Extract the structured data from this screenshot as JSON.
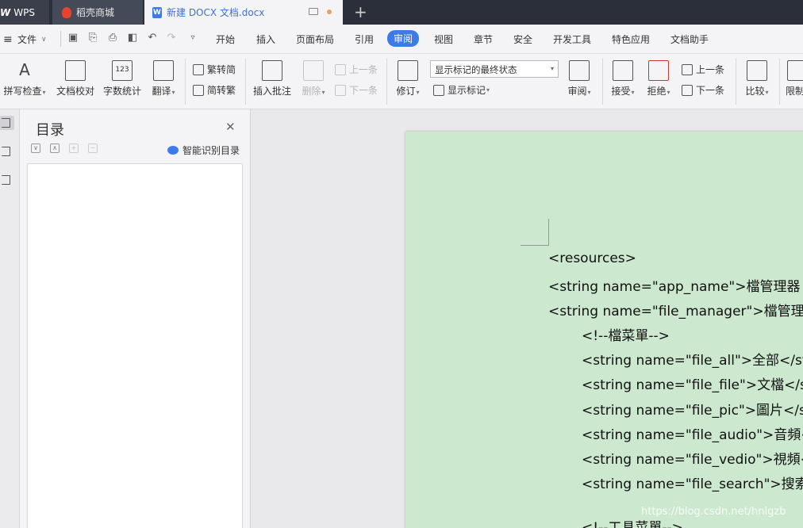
{
  "tabs": {
    "wps": "WPS",
    "store": "稻壳商城",
    "doc": "新建 DOCX 文档.docx"
  },
  "menu": {
    "file": "文件",
    "items": [
      "开始",
      "插入",
      "页面布局",
      "引用",
      "审阅",
      "视图",
      "章节",
      "安全",
      "开发工具",
      "特色应用",
      "文档助手"
    ],
    "active": "审阅"
  },
  "ribbon": {
    "spell_check": "拼写检查",
    "doc_proof": "文档校对",
    "word_count": "字数统计",
    "translate": "翻译",
    "trad_to_simp": "繁转简",
    "simp_to_trad": "简转繁",
    "insert_comment": "插入批注",
    "delete": "删除",
    "prev_comment": "上一条",
    "next_comment": "下一条",
    "track_changes": "修订",
    "markup_select": "显示标记的最终状态",
    "show_markup": "显示标记",
    "review": "审阅",
    "accept": "接受",
    "reject": "拒绝",
    "prev_change": "上一条",
    "next_change": "下一条",
    "compare": "比较",
    "restrict": "限制"
  },
  "nav": {
    "title": "目录",
    "smart": "智能识别目录"
  },
  "document": {
    "lines": [
      "<resources>",
      "<string name=\"app_name\">檔管理器",
      "<string name=\"file_manager\">檔管理",
      "<!--檔菜單-->",
      "<string name=\"file_all\">全部</st",
      "<string name=\"file_file\">文檔</s",
      "<string name=\"file_pic\">圖片</s",
      "<string name=\"file_audio\">音頻<",
      "<string name=\"file_vedio\">視頻<",
      "<string name=\"file_search\">搜索",
      "<!--工具菜單-->"
    ],
    "watermark": "https://blog.csdn.net/hnlgzb"
  }
}
